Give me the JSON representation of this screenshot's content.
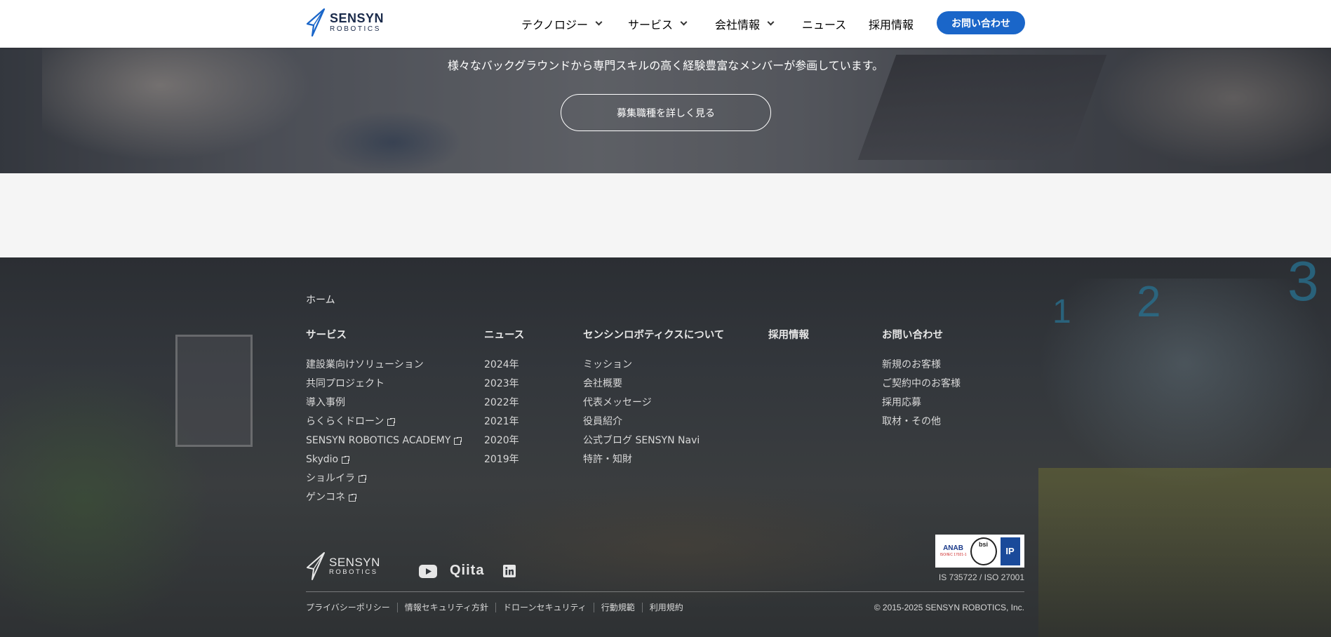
{
  "header": {
    "logo_main": "SENSYN",
    "logo_sub": "ROBOTICS",
    "nav": [
      {
        "label": "テクノロジー",
        "dropdown": true
      },
      {
        "label": "サービス",
        "dropdown": true
      },
      {
        "label": "会社情報",
        "dropdown": true
      },
      {
        "label": "ニュース",
        "dropdown": false
      },
      {
        "label": "採用情報",
        "dropdown": false
      }
    ],
    "cta_label": "お問い合わせ"
  },
  "hero": {
    "text": "様々なバックグラウンドから専門スキルの高く経験豊富なメンバーが参画しています。",
    "button_label": "募集職種を詳しく見る"
  },
  "footer": {
    "home": "ホーム",
    "columns": [
      {
        "title": "サービス",
        "links": [
          {
            "label": "建設業向けソリューション",
            "external": false
          },
          {
            "label": "共同プロジェクト",
            "external": false
          },
          {
            "label": "導入事例",
            "external": false
          },
          {
            "label": "らくらくドローン",
            "external": true
          },
          {
            "label": "SENSYN ROBOTICS ACADEMY",
            "external": true
          },
          {
            "label": "Skydio",
            "external": true
          },
          {
            "label": "ショルイラ",
            "external": true
          },
          {
            "label": "ゲンコネ",
            "external": true
          }
        ]
      },
      {
        "title": "ニュース",
        "links": [
          {
            "label": "2024年",
            "external": false
          },
          {
            "label": "2023年",
            "external": false
          },
          {
            "label": "2022年",
            "external": false
          },
          {
            "label": "2021年",
            "external": false
          },
          {
            "label": "2020年",
            "external": false
          },
          {
            "label": "2019年",
            "external": false
          }
        ]
      },
      {
        "title": "センシンロボティクスについて",
        "links": [
          {
            "label": "ミッション",
            "external": false
          },
          {
            "label": "会社概要",
            "external": false
          },
          {
            "label": "代表メッセージ",
            "external": false
          },
          {
            "label": "役員紹介",
            "external": false
          },
          {
            "label": "公式ブログ SENSYN Navi",
            "external": false
          },
          {
            "label": "特許・知財",
            "external": false
          }
        ]
      },
      {
        "title": "採用情報",
        "links": []
      },
      {
        "title": "お問い合わせ",
        "links": [
          {
            "label": "新規のお客様",
            "external": false
          },
          {
            "label": "ご契約中のお客様",
            "external": false
          },
          {
            "label": "採用応募",
            "external": false
          },
          {
            "label": "取材・その他",
            "external": false
          }
        ]
      }
    ],
    "logo_main": "SENSYN",
    "logo_sub": "ROBOTICS",
    "social": {
      "youtube": "youtube-icon",
      "qiita": "Qiita",
      "linkedin": "linkedin-icon"
    },
    "cert": {
      "anab": "ANAB",
      "bsi": "bsi",
      "text": "IS 735722 / ISO 27001"
    },
    "legal": [
      "プライバシーポリシー",
      "情報セキュリティ方針",
      "ドローンセキュリティ",
      "行動規範",
      "利用規約"
    ],
    "copyright": "© 2015-2025 SENSYN ROBOTICS, Inc."
  },
  "colors": {
    "accent": "#1a66c9",
    "logo_navy": "#1a2a4a",
    "footer_text": "#d8d8d8"
  }
}
